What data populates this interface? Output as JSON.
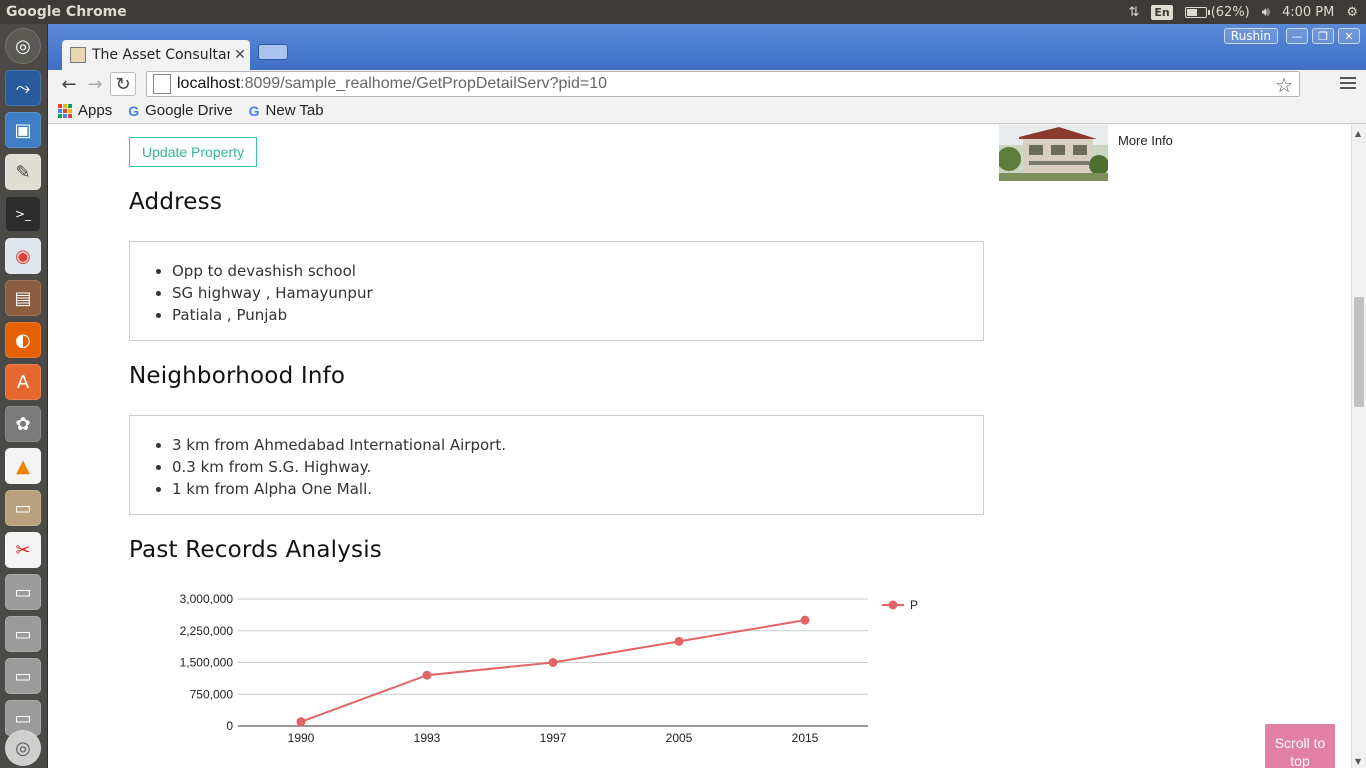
{
  "system_panel": {
    "app_name": "Google Chrome",
    "keyboard_layout": "En",
    "battery_label": "(62%)",
    "battery_level": 0.62,
    "clock": "4:00 PM"
  },
  "browser": {
    "tab_title": "The Asset Consultan",
    "profile_name": "Rushin",
    "url_host": "localhost",
    "url_path": ":8099/sample_realhome/GetPropDetailServ?pid=10",
    "bookmarks": [
      {
        "label": "Apps"
      },
      {
        "label": "Google Drive"
      },
      {
        "label": "New Tab"
      }
    ]
  },
  "page": {
    "update_button": "Update Property",
    "more_info": "More Info",
    "address": {
      "heading": "Address",
      "lines": [
        "Opp to devashish school",
        "SG highway , Hamayunpur",
        "Patiala , Punjab"
      ]
    },
    "neighborhood": {
      "heading": "Neighborhood Info",
      "lines": [
        "3 km from Ahmedabad International Airport.",
        "0.3 km from S.G. Highway.",
        "1 km from Alpha One Mall."
      ]
    },
    "records": {
      "heading": "Past Records Analysis"
    },
    "scroll_to_top": "Scroll to top"
  },
  "chart_data": {
    "type": "line",
    "categories": [
      "1990",
      "1993",
      "1997",
      "2005",
      "2015"
    ],
    "series": [
      {
        "name": "Price",
        "values": [
          100000,
          1200000,
          1500000,
          2000000,
          2500000
        ],
        "color": "#e06666"
      }
    ],
    "yticks": [
      "0",
      "750,000",
      "1,500,000",
      "2,250,000",
      "3,000,000"
    ],
    "ylim": [
      0,
      3000000
    ],
    "legend": "right",
    "grid": true
  }
}
